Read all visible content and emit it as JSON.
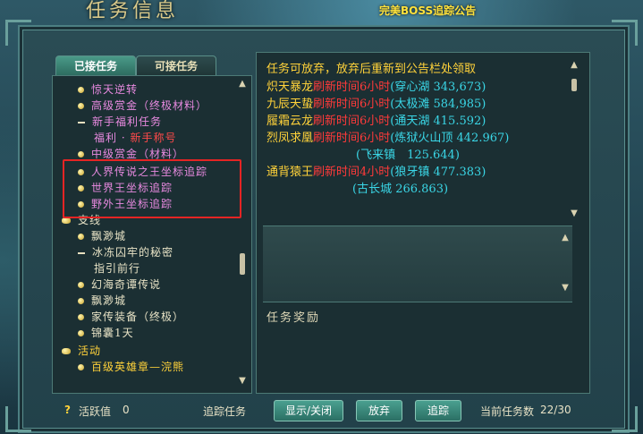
{
  "window": {
    "title": "任务信息",
    "boss_banner": "完美BOSS追踪公告"
  },
  "tabs": [
    {
      "label": "已接任务"
    },
    {
      "label": "可接任务"
    }
  ],
  "tree": [
    {
      "text": "惊天逆转",
      "kind": "item",
      "color": "#e88ae0"
    },
    {
      "text": "高级赏金（终极材料）",
      "kind": "item",
      "color": "#e88ae0"
    },
    {
      "text": "新手福利任务",
      "kind": "expanded",
      "color": "#e88ae0"
    },
    {
      "text": "福利 · ",
      "text2": "新手称号",
      "kind": "subitem",
      "color": "#e88ae0",
      "color2": "#ff4a4a"
    },
    {
      "text": "中级赏金（材料）",
      "kind": "item",
      "color": "#e88ae0"
    },
    {
      "text": "人界传说之王坐标追踪",
      "kind": "item",
      "color": "#e88ae0"
    },
    {
      "text": "世界王坐标追踪",
      "kind": "item",
      "color": "#e88ae0"
    },
    {
      "text": "野外王坐标追踪",
      "kind": "item",
      "color": "#e88ae0"
    },
    {
      "text": "支线",
      "kind": "category",
      "color": "#e8e3c6"
    },
    {
      "text": "飘渺城",
      "kind": "item",
      "color": "#e8e3c6"
    },
    {
      "text": "冰冻囚牢的秘密",
      "kind": "expanded",
      "color": "#e8e3c6"
    },
    {
      "text": "指引前行",
      "kind": "subitem",
      "color": "#e8e3c6"
    },
    {
      "text": "幻海奇谭传说",
      "kind": "item",
      "color": "#e8e3c6"
    },
    {
      "text": "飘渺城",
      "kind": "item",
      "color": "#e8e3c6"
    },
    {
      "text": "家传装备（终极）",
      "kind": "item",
      "color": "#e8e3c6"
    },
    {
      "text": "锦囊1天",
      "kind": "item",
      "color": "#e8e3c6"
    },
    {
      "text": "活动",
      "kind": "category",
      "color": "#ffd23a"
    },
    {
      "text": "百级英雄章—浣熊",
      "kind": "item",
      "color": "#ffd23a"
    }
  ],
  "details": {
    "header": "任务可放弃，放弃后重新到公告栏处领取",
    "entries": [
      {
        "name": "炽天暴龙",
        "refresh": "刷新时间6小时",
        "loc": "(穿心湖 343,673)"
      },
      {
        "name": "九辰天蛰",
        "refresh": "刷新时间6小时",
        "loc": "(太极滩 584,985)"
      },
      {
        "name": "履霜云龙",
        "refresh": "刷新时间6小时",
        "loc": "(通天湖 415.592)"
      },
      {
        "name": "烈凤求凰",
        "refresh": "刷新时间6小时",
        "loc": "(炼狱火山顶 442.967)"
      },
      {
        "name": "",
        "refresh": "",
        "loc": "(飞来镇　125.644)"
      },
      {
        "name": "通背猿王",
        "refresh": "刷新时间4小时",
        "loc": "(狼牙镇 477.383)"
      },
      {
        "name": "",
        "refresh": "",
        "loc": "(古长城 266.863)"
      }
    ],
    "reward_label": "任务奖励"
  },
  "bottom": {
    "help_icon": "?",
    "activity_label": "活跃值",
    "activity_value": "0",
    "track_label": "追踪任务",
    "toggle_button": "显示/关闭",
    "abandon_button": "放弃",
    "track_button": "追踪",
    "count_label": "当前任务数",
    "count_value": "22/30"
  },
  "colors": {
    "name": "#ffd23a",
    "refresh": "#ff3a3a",
    "location": "#3ad6e6",
    "header": "#ffd23a"
  }
}
